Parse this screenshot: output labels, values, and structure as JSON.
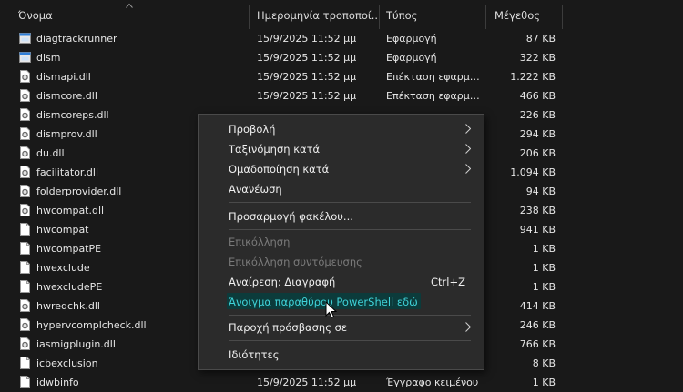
{
  "header": {
    "name": "Όνομα",
    "date": "Ημερομηνία τροποποί...",
    "type": "Τύπος",
    "size": "Μέγεθος"
  },
  "files": [
    {
      "name": "diagtrackrunner",
      "date": "15/9/2025 11:52 μμ",
      "type": "Εφαρμογή",
      "size": "87 KB",
      "icon": "app-icon"
    },
    {
      "name": "dism",
      "date": "15/9/2025 11:52 μμ",
      "type": "Εφαρμογή",
      "size": "322 KB",
      "icon": "app-icon"
    },
    {
      "name": "dismapi.dll",
      "date": "15/9/2025 11:52 μμ",
      "type": "Επέκταση εφαρμογής",
      "size": "1.222 KB",
      "icon": "dll-icon"
    },
    {
      "name": "dismcore.dll",
      "date": "15/9/2025 11:52 μμ",
      "type": "Επέκταση εφαρμογής",
      "size": "466 KB",
      "icon": "dll-icon"
    },
    {
      "name": "dismcoreps.dll",
      "date": "",
      "type": "",
      "size": "226 KB",
      "icon": "dll-icon"
    },
    {
      "name": "dismprov.dll",
      "date": "",
      "type": "",
      "size": "294 KB",
      "icon": "dll-icon"
    },
    {
      "name": "du.dll",
      "date": "",
      "type": "",
      "size": "206 KB",
      "icon": "dll-icon"
    },
    {
      "name": "facilitator.dll",
      "date": "",
      "type": "",
      "size": "1.094 KB",
      "icon": "dll-icon"
    },
    {
      "name": "folderprovider.dll",
      "date": "",
      "type": "",
      "size": "94 KB",
      "icon": "dll-icon"
    },
    {
      "name": "hwcompat.dll",
      "date": "",
      "type": "",
      "size": "238 KB",
      "icon": "dll-icon"
    },
    {
      "name": "hwcompat",
      "date": "",
      "type": "",
      "size": "941 KB",
      "icon": "file-icon"
    },
    {
      "name": "hwcompatPE",
      "date": "",
      "type": "",
      "size": "1 KB",
      "icon": "file-icon"
    },
    {
      "name": "hwexclude",
      "date": "",
      "type": "",
      "size": "1 KB",
      "icon": "file-icon"
    },
    {
      "name": "hwexcludePE",
      "date": "",
      "type": "",
      "size": "1 KB",
      "icon": "file-icon"
    },
    {
      "name": "hwreqchk.dll",
      "date": "",
      "type": "",
      "size": "414 KB",
      "icon": "dll-icon"
    },
    {
      "name": "hypervcomplcheck.dll",
      "date": "",
      "type": "",
      "size": "246 KB",
      "icon": "dll-icon"
    },
    {
      "name": "iasmigplugin.dll",
      "date": "",
      "type": "",
      "size": "766 KB",
      "icon": "dll-icon"
    },
    {
      "name": "icbexclusion",
      "date": "",
      "type": "",
      "size": "8 KB",
      "icon": "file-icon"
    },
    {
      "name": "idwbinfo",
      "date": "15/9/2025 11:52 μμ",
      "type": "Έγγραφο κειμένου",
      "size": "1 KB",
      "icon": "file-icon"
    }
  ],
  "context_menu": {
    "view": "Προβολή",
    "sort_by": "Ταξινόμηση κατά",
    "group_by": "Ομαδοποίηση κατά",
    "refresh": "Ανανέωση",
    "customize": "Προσαρμογή φακέλου...",
    "paste": "Επικόλληση",
    "paste_shortcut": "Επικόλληση συντόμευσης",
    "undo_delete": "Αναίρεση: Διαγραφή",
    "undo_shortcut": "Ctrl+Z",
    "powershell": "Άνοιγμα παραθύρου PowerShell εδώ",
    "give_access": "Παροχή πρόσβασης σε",
    "properties": "Ιδιότητες"
  },
  "colors": {
    "background": "#191919",
    "menu_background": "#2b2b2b",
    "highlight_text": "#3fd2d8",
    "highlight_bg": "#0c3b3b"
  }
}
